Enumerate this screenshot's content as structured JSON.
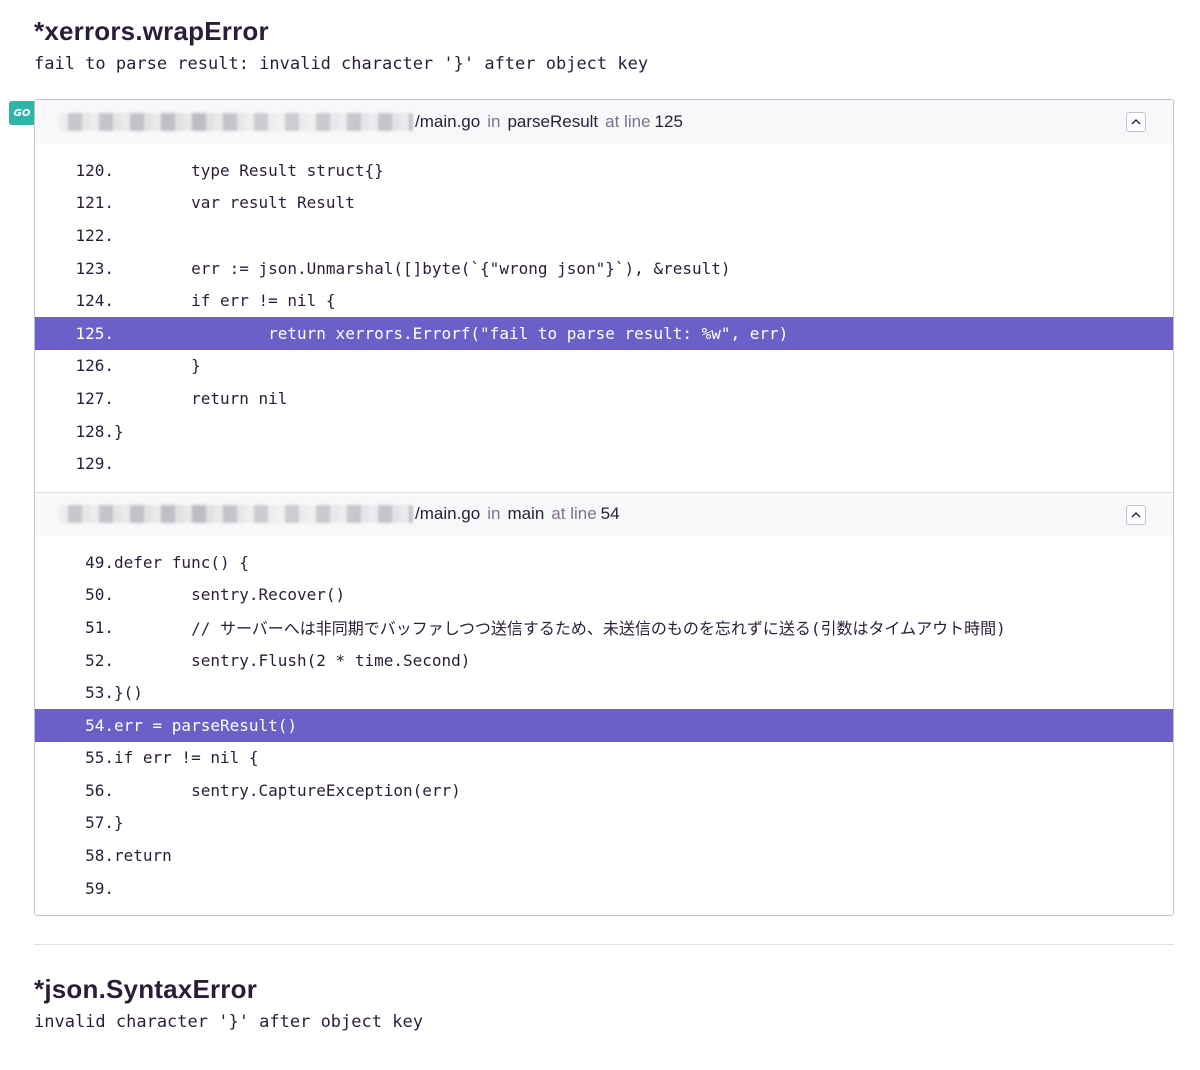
{
  "exceptions": [
    {
      "type": "*xerrors.wrapError",
      "value": "fail to parse result: invalid character '}' after object key"
    },
    {
      "type": "*json.SyntaxError",
      "value": "invalid character '}' after object key"
    }
  ],
  "platform_badge": "GO",
  "stacktrace": {
    "frames": [
      {
        "filename": "/main.go",
        "in_label": "in",
        "function": "parseResult",
        "at_line_label": "at line",
        "lineno": "125",
        "lines": [
          {
            "no": "120.",
            "code": "        type Result struct{}",
            "active": false
          },
          {
            "no": "121.",
            "code": "        var result Result",
            "active": false
          },
          {
            "no": "122.",
            "code": "",
            "active": false
          },
          {
            "no": "123.",
            "code": "        err := json.Unmarshal([]byte(`{\"wrong json\"}`), &result)",
            "active": false
          },
          {
            "no": "124.",
            "code": "        if err != nil {",
            "active": false
          },
          {
            "no": "125.",
            "code": "                return xerrors.Errorf(\"fail to parse result: %w\", err)",
            "active": true
          },
          {
            "no": "126.",
            "code": "        }",
            "active": false
          },
          {
            "no": "127.",
            "code": "        return nil",
            "active": false
          },
          {
            "no": "128.",
            "code": "}",
            "active": false
          },
          {
            "no": "129.",
            "code": "",
            "active": false
          }
        ]
      },
      {
        "filename": "/main.go",
        "in_label": "in",
        "function": "main",
        "at_line_label": "at line",
        "lineno": "54",
        "lines": [
          {
            "no": "49.",
            "code": "defer func() {",
            "active": false
          },
          {
            "no": "50.",
            "code": "        sentry.Recover()",
            "active": false
          },
          {
            "no": "51.",
            "code": "        // サーバーへは非同期でバッファしつつ送信するため、未送信のものを忘れずに送る(引数はタイムアウト時間)",
            "active": false
          },
          {
            "no": "52.",
            "code": "        sentry.Flush(2 * time.Second)",
            "active": false
          },
          {
            "no": "53.",
            "code": "}()",
            "active": false
          },
          {
            "no": "54.",
            "code": "err = parseResult()",
            "active": true
          },
          {
            "no": "55.",
            "code": "if err != nil {",
            "active": false
          },
          {
            "no": "56.",
            "code": "        sentry.CaptureException(err)",
            "active": false
          },
          {
            "no": "57.",
            "code": "}",
            "active": false
          },
          {
            "no": "58.",
            "code": "return",
            "active": false
          },
          {
            "no": "59.",
            "code": "",
            "active": false
          }
        ]
      }
    ]
  },
  "icons": {
    "collapse": "chevron-up-icon"
  },
  "colors": {
    "active_line": "#6c5fc7",
    "badge": "#2fb5a7",
    "text": "#2b1d38",
    "muted": "#80708f"
  }
}
